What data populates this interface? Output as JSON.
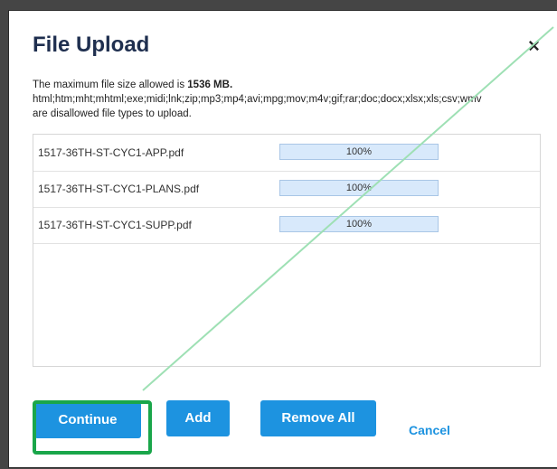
{
  "dialog": {
    "title": "File Upload",
    "close_label": "×",
    "max_size_prefix": "The maximum file size allowed is ",
    "max_size_value": "1536 MB.",
    "disallowed_types": "html;htm;mht;mhtml;exe;midi;lnk;zip;mp3;mp4;avi;mpg;mov;m4v;gif;rar;doc;docx;xlsx;xls;csv;wmv",
    "disallowed_suffix": "are disallowed file types to upload."
  },
  "files": [
    {
      "name": "1517-36TH-ST-CYC1-APP.pdf",
      "progress_label": "100%",
      "progress": 1.0
    },
    {
      "name": "1517-36TH-ST-CYC1-PLANS.pdf",
      "progress_label": "100%",
      "progress": 1.0
    },
    {
      "name": "1517-36TH-ST-CYC1-SUPP.pdf",
      "progress_label": "100%",
      "progress": 1.0
    }
  ],
  "buttons": {
    "continue": "Continue",
    "add": "Add",
    "remove_all": "Remove All",
    "cancel": "Cancel"
  },
  "colors": {
    "accent": "#1d93e0",
    "highlight": "#1aa64a",
    "title": "#1f2f4f"
  }
}
